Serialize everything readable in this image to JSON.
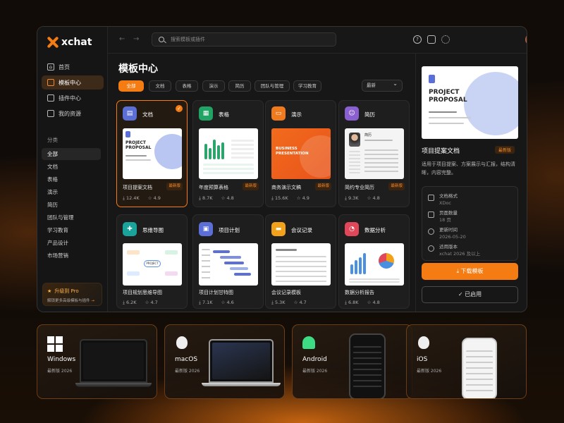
{
  "app": {
    "name": "xchat"
  },
  "sidebar": {
    "nav": [
      {
        "label": "首页",
        "icon": "home-icon"
      },
      {
        "label": "模板中心",
        "icon": "template-icon"
      },
      {
        "label": "插件中心",
        "icon": "plugin-icon"
      },
      {
        "label": "我的资源",
        "icon": "resource-icon"
      }
    ],
    "active_nav": "模板中心",
    "category_title": "分类",
    "categories": [
      "全部",
      "文档",
      "表格",
      "演示",
      "简历",
      "团队与管理",
      "学习教育",
      "产品设计",
      "市场营销"
    ],
    "upgrade": {
      "title": "升级到 Pro",
      "subtitle": "解锁更多高级模板与插件"
    }
  },
  "topbar": {
    "search_placeholder": "搜索模板或插件"
  },
  "main": {
    "title": "模板中心",
    "filters": [
      "全部",
      "文档",
      "表格",
      "演示",
      "简历",
      "团队与管理",
      "学习教育"
    ],
    "active_filter": "全部",
    "sort": "最新",
    "cards": [
      {
        "type": "文档",
        "title": "项目提案文档",
        "badge": "最新版",
        "downloads": "12.4K",
        "rating": "4.9",
        "color": "#5b6fd6",
        "selected": true
      },
      {
        "type": "表格",
        "title": "年度预算表格",
        "badge": "最新版",
        "downloads": "8.7K",
        "rating": "4.8",
        "color": "#21a366"
      },
      {
        "type": "演示",
        "title": "商务演示文稿",
        "badge": "最新版",
        "downloads": "15.6K",
        "rating": "4.9",
        "color": "#f07a1e"
      },
      {
        "type": "简历",
        "title": "简约专业简历",
        "badge": "最新版",
        "downloads": "9.3K",
        "rating": "4.8",
        "color": "#8a5fd0"
      },
      {
        "type": "思维导图",
        "title": "项目规划思维导图",
        "downloads": "6.2K",
        "rating": "4.7",
        "color": "#1aa39a"
      },
      {
        "type": "项目计划",
        "title": "项目计划甘特图",
        "downloads": "7.1K",
        "rating": "4.6",
        "color": "#5b6fd6"
      },
      {
        "type": "会议记录",
        "title": "会议记录模板",
        "downloads": "5.3K",
        "rating": "4.7",
        "color": "#f2a11a"
      },
      {
        "type": "数据分析",
        "title": "数据分析报告",
        "downloads": "6.8K",
        "rating": "4.8",
        "color": "#e0485a"
      }
    ],
    "preview_texts": {
      "doc": "PROJECT PROPOSAL",
      "ppt": "BUSINESS PRESENTATION",
      "resume_name": "简历",
      "mindmap": "PROJECT"
    }
  },
  "detail": {
    "preview_title": "PROJECT PROPOSAL",
    "name": "项目提案文档",
    "badge": "最新版",
    "description": "适用于项目提案、方案展示与汇报，结构清晰，内容完整。",
    "meta": [
      {
        "label": "文档格式",
        "value": "XDoc",
        "icon": "file-icon"
      },
      {
        "label": "页面数量",
        "value": "18 页",
        "icon": "pages-icon"
      },
      {
        "label": "更新时间",
        "value": "2026-05-20",
        "icon": "clock-icon"
      },
      {
        "label": "适用版本",
        "value": "xchat 2026 及以上",
        "icon": "check-circle-icon"
      }
    ],
    "download_label": "下载模板",
    "enabled_label": "已启用"
  },
  "platforms": [
    {
      "name": "Windows",
      "version": "最新版 2026",
      "icon": "windows-icon"
    },
    {
      "name": "macOS",
      "version": "最新版 2026",
      "icon": "apple-icon"
    },
    {
      "name": "Android",
      "version": "最新版 2026",
      "icon": "android-icon"
    },
    {
      "name": "iOS",
      "version": "最新版 2026",
      "icon": "apple-icon"
    }
  ],
  "colors": {
    "accent": "#f57c12",
    "window_bg": "#171717"
  }
}
